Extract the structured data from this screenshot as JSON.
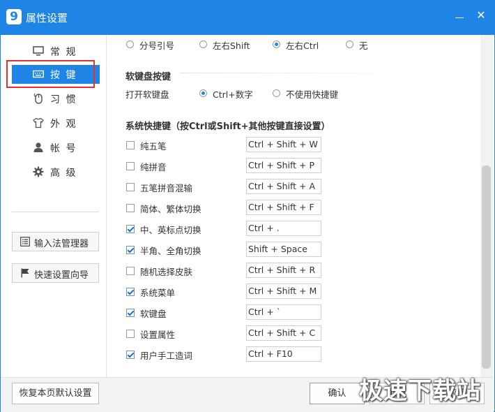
{
  "window": {
    "app_icon_letter": "9",
    "title": "属性设置",
    "minimize": "—",
    "close": "✕"
  },
  "sidebar": {
    "items": [
      {
        "label": "常 规",
        "icon": "monitor-icon"
      },
      {
        "label": "按 键",
        "icon": "keyboard-icon",
        "active": true
      },
      {
        "label": "习 惯",
        "icon": "mouse-icon"
      },
      {
        "label": "外 观",
        "icon": "shirt-icon"
      },
      {
        "label": "帐 号",
        "icon": "user-icon"
      },
      {
        "label": "高 级",
        "icon": "gear-icon"
      }
    ],
    "ime_manager": "输入法管理器",
    "quick_setup": "快速设置向导"
  },
  "main": {
    "top_options": [
      "分号引号",
      "左右Shift",
      "左右Ctrl",
      "无"
    ],
    "top_selected": "左右Ctrl",
    "soft_keyboard": {
      "heading": "软键盘按键",
      "label": "打开软键盘",
      "options": [
        "Ctrl+数字",
        "不使用快捷键"
      ],
      "selected": "Ctrl+数字"
    },
    "hotkeys": {
      "heading": "系统快捷键（按Ctrl或Shift+其他按键直接设置）",
      "rows": [
        {
          "label": "纯五笔",
          "checked": false,
          "value": "Ctrl + Shift + W"
        },
        {
          "label": "纯拼音",
          "checked": false,
          "value": "Ctrl + Shift + P"
        },
        {
          "label": "五笔拼音混输",
          "checked": false,
          "value": "Ctrl + Shift + A"
        },
        {
          "label": "简体、繁体切换",
          "checked": false,
          "value": "Ctrl + Shift + F"
        },
        {
          "label": "中、英标点切换",
          "checked": true,
          "value": "Ctrl + ."
        },
        {
          "label": "半角、全角切换",
          "checked": true,
          "value": "Shift + Space"
        },
        {
          "label": "随机选择皮肤",
          "checked": false,
          "value": "Ctrl + Shift + R"
        },
        {
          "label": "系统菜单",
          "checked": true,
          "value": "Ctrl + Shift + M"
        },
        {
          "label": "软键盘",
          "checked": true,
          "value": "Ctrl + `"
        },
        {
          "label": "设置属性",
          "checked": false,
          "value": "Ctrl + Shift + C"
        },
        {
          "label": "用户手工造词",
          "checked": true,
          "value": "Ctrl + F10"
        }
      ]
    }
  },
  "footer": {
    "restore_defaults": "恢复本页默认设置",
    "confirm": "确认",
    "cancel": "取消",
    "apply": "应用"
  },
  "watermark": "极速下载站",
  "colors": {
    "accent": "#1e84e5",
    "highlight_box": "#e3322c"
  }
}
